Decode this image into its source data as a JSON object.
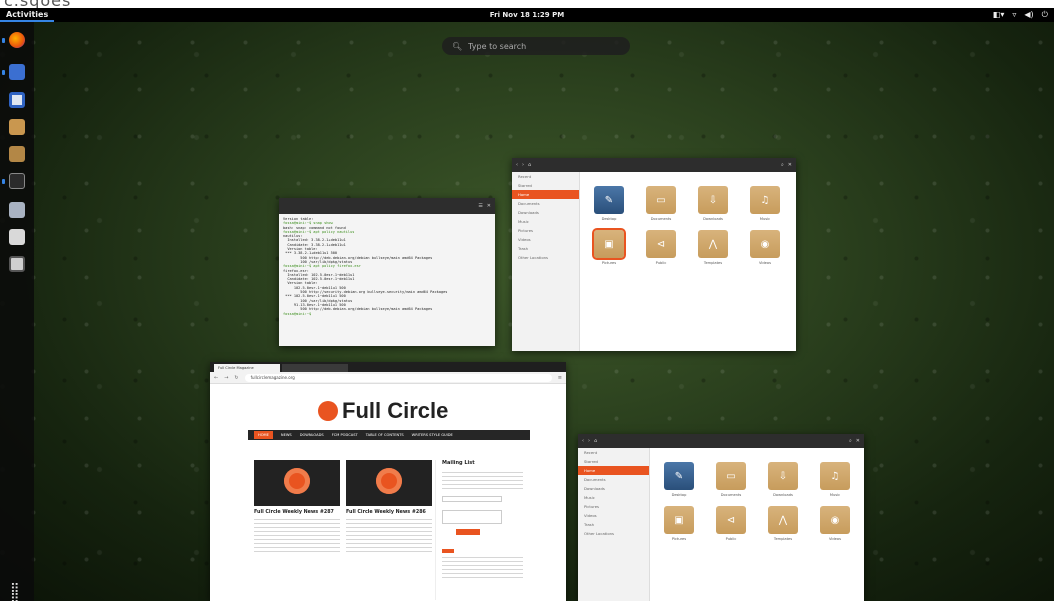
{
  "topbar": {
    "activities": "Activities",
    "clock": "Fri Nov 18  1:29 PM"
  },
  "search": {
    "placeholder": "Type to search"
  },
  "terminal": {
    "lines": [
      "Version table:",
      "fossa@mini:~$ snap show",
      "bash: snap: command not found",
      "fossa@mini:~$ apt policy nautilus",
      "nautilus:",
      "  Installed: 3.38.2-1+deb11u1",
      "  Candidate: 3.38.2-1+deb11u1",
      "  Version table:",
      " *** 3.38.2-1+deb11u1 500",
      "        500 http://deb.debian.org/debian bullseye/main amd64 Packages",
      "        100 /var/lib/dpkg/status",
      "fossa@mini:~$ apt policy firefox-esr",
      "firefox-esr:",
      "  Installed: 102.5.0esr-1~deb11u1",
      "  Candidate: 102.5.0esr-1~deb11u1",
      "  Version table:",
      "     102.5.0esr-1~deb11u1 500",
      "        500 http://security.debian.org bullseye-security/main amd64 Packages",
      " *** 102.5.0esr-1~deb11u1 500",
      "        100 /var/lib/dpkg/status",
      "     91.13.0esr-1~deb11u1 500",
      "        500 http://deb.debian.org/debian bullseye/main amd64 Packages",
      "fossa@mini:~$"
    ]
  },
  "files": {
    "sidebar": [
      "Recent",
      "Starred",
      "Home",
      "Documents",
      "Downloads",
      "Music",
      "Pictures",
      "Videos",
      "Trash",
      "Other Locations"
    ],
    "folders": [
      "Desktop",
      "Documents",
      "Downloads",
      "Music",
      "Pictures",
      "Public",
      "Templates",
      "Videos"
    ]
  },
  "browser": {
    "tab_active": "Full Circle Magazine",
    "url": "fullcirclemagazine.org",
    "site_title": "Full Circle",
    "nav": [
      "HOME",
      "NEWS",
      "DOWNLOADS",
      "FCM PODCAST",
      "TABLE OF CONTENTS",
      "WRITERS STYLE GUIDE"
    ],
    "posts": [
      {
        "title": "Full Circle Weekly News #287"
      },
      {
        "title": "Full Circle Weekly News #286"
      }
    ],
    "mailing_list": "Mailing List"
  },
  "colors": {
    "accent": "#e95420",
    "highlight": "#3584e4"
  }
}
